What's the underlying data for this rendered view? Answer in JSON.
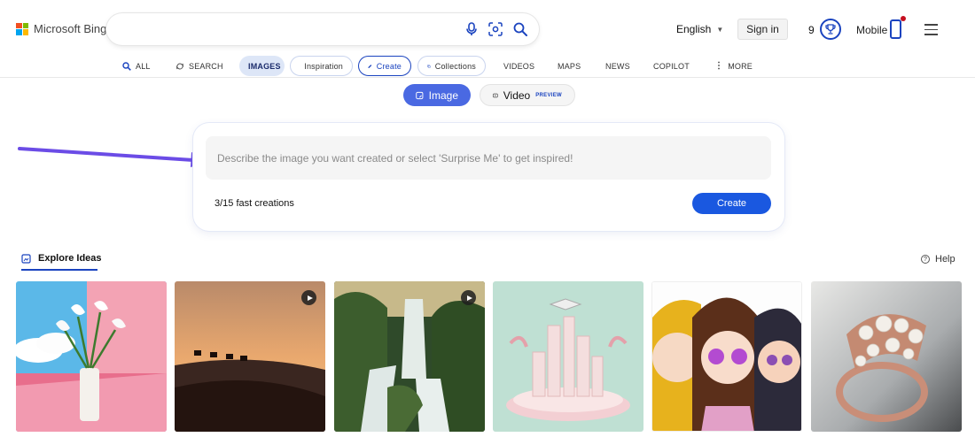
{
  "brand": {
    "name": "Microsoft Bing",
    "colors": [
      "#f25022",
      "#7fba00",
      "#00a4ef",
      "#ffb900"
    ]
  },
  "search": {
    "value": "",
    "placeholder": ""
  },
  "header": {
    "language": "English",
    "sign_in": "Sign in",
    "points": "9",
    "mobile": "Mobile"
  },
  "nav": {
    "items": [
      {
        "label": "ALL",
        "icon": "search-icon"
      },
      {
        "label": "SEARCH",
        "icon": "copilot-icon"
      },
      {
        "label": "IMAGES",
        "icon": ""
      },
      {
        "label": "Inspiration",
        "icon": "inspiration-icon"
      },
      {
        "label": "Create",
        "icon": "create-icon"
      },
      {
        "label": "Collections",
        "icon": "collections-icon"
      },
      {
        "label": "VIDEOS",
        "icon": ""
      },
      {
        "label": "MAPS",
        "icon": ""
      },
      {
        "label": "NEWS",
        "icon": ""
      },
      {
        "label": "COPILOT",
        "icon": ""
      },
      {
        "label": "MORE",
        "icon": "more-icon"
      }
    ],
    "active": "IMAGES"
  },
  "mode_toggle": {
    "image_label": "Image",
    "video_label": "Video",
    "video_badge": "PREVIEW"
  },
  "creator": {
    "prompt_value": "",
    "prompt_placeholder": "Describe the image you want created or select 'Surprise Me' to get inspired!",
    "fast_creations": "3/15 fast creations",
    "create_label": "Create"
  },
  "explore": {
    "title": "Explore Ideas",
    "help": "Help",
    "tiles": [
      {
        "subject": "calla-lilies",
        "has_video": false
      },
      {
        "subject": "desert-camels-sunset",
        "has_video": true
      },
      {
        "subject": "waterfall",
        "has_video": true
      },
      {
        "subject": "graduation-city",
        "has_video": false
      },
      {
        "subject": "anime-characters",
        "has_video": false
      },
      {
        "subject": "pearl-ring",
        "has_video": false
      }
    ]
  },
  "accent": "#1a43bf",
  "annotation_arrow_color": "#6b4ce6"
}
